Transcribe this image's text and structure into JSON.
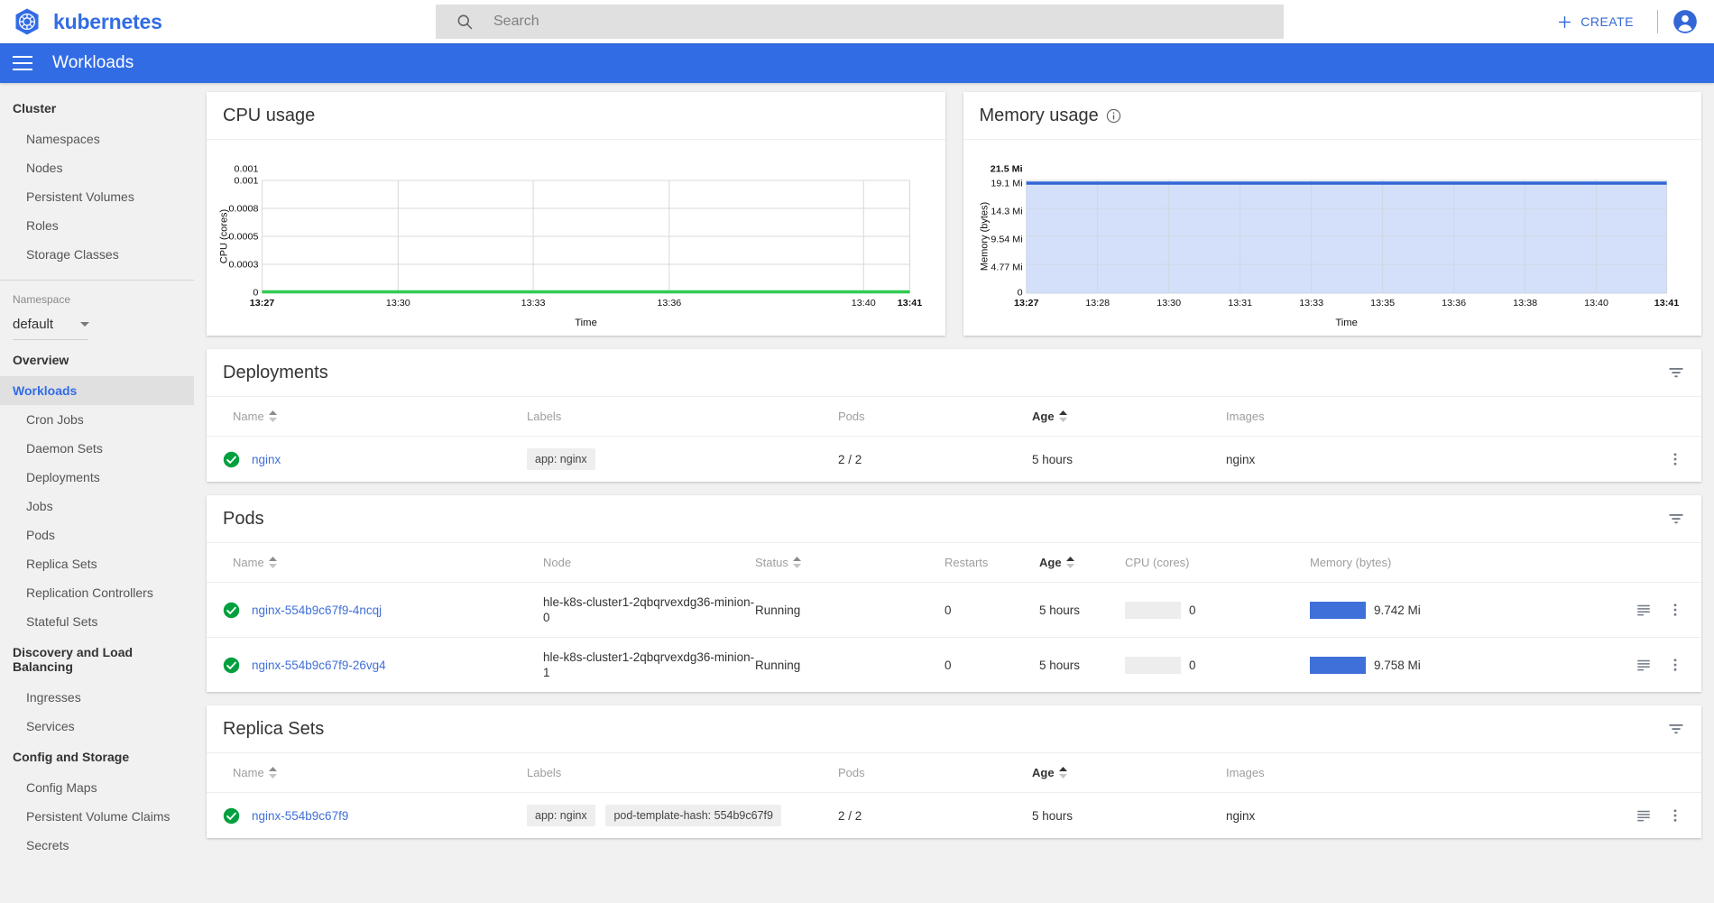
{
  "header": {
    "brand": "kubernetes",
    "logo_icon": "kubernetes-wheel-icon",
    "search_placeholder": "Search",
    "search_value": "",
    "search_icon": "search-icon",
    "create_label": "CREATE",
    "plus_icon": "plus-icon",
    "account_icon": "account-circle-icon"
  },
  "actionbar": {
    "menu_icon": "hamburger-menu-icon",
    "title": "Workloads"
  },
  "colors": {
    "brand_blue": "#326ce5",
    "link_blue": "#3f6fd8",
    "status_green": "#00a03e",
    "bar_blue": "#3f6fd8",
    "sidebar_bg": "#f1f1f1"
  },
  "sidebar": {
    "sections": [
      {
        "title": "Cluster",
        "items": [
          {
            "label": "Namespaces",
            "active": false
          },
          {
            "label": "Nodes",
            "active": false
          },
          {
            "label": "Persistent Volumes",
            "active": false
          },
          {
            "label": "Roles",
            "active": false
          },
          {
            "label": "Storage Classes",
            "active": false
          }
        ]
      },
      {
        "title": "Overview",
        "items": [
          {
            "label": "Workloads",
            "active": true
          },
          {
            "label": "Cron Jobs",
            "active": false
          },
          {
            "label": "Daemon Sets",
            "active": false
          },
          {
            "label": "Deployments",
            "active": false
          },
          {
            "label": "Jobs",
            "active": false
          },
          {
            "label": "Pods",
            "active": false
          },
          {
            "label": "Replica Sets",
            "active": false
          },
          {
            "label": "Replication Controllers",
            "active": false
          },
          {
            "label": "Stateful Sets",
            "active": false
          }
        ]
      },
      {
        "title": "Discovery and Load Balancing",
        "items": [
          {
            "label": "Ingresses",
            "active": false
          },
          {
            "label": "Services",
            "active": false
          }
        ]
      },
      {
        "title": "Config and Storage",
        "items": [
          {
            "label": "Config Maps",
            "active": false
          },
          {
            "label": "Persistent Volume Claims",
            "active": false
          },
          {
            "label": "Secrets",
            "active": false
          }
        ]
      }
    ],
    "namespace": {
      "label": "Namespace",
      "value": "default",
      "caret_icon": "chevron-down-icon"
    }
  },
  "chart_data": [
    {
      "type": "area",
      "title": "CPU usage",
      "xlabel": "Time",
      "ylabel": "CPU (cores)",
      "ytick_labels": [
        "0.001",
        "0.001",
        "0.0008",
        "0.0005",
        "0.0003",
        "0"
      ],
      "ytick_values": [
        0.0011,
        0.001,
        0.0008,
        0.0005,
        0.0003,
        0
      ],
      "ylim": [
        0,
        0.0011
      ],
      "xtick_labels": [
        "13:27",
        "13:30",
        "13:33",
        "13:36",
        "13:40",
        "13:41"
      ],
      "x": [
        "13:27",
        "13:30",
        "13:33",
        "13:36",
        "13:40",
        "13:41"
      ],
      "values": [
        0,
        0,
        0,
        0,
        0,
        0
      ],
      "line_color": "#2ecc51",
      "fill_color": "#d9f0df",
      "grid": true,
      "legend": "none"
    },
    {
      "type": "area",
      "title": "Memory usage",
      "info_icon": "info-icon",
      "xlabel": "Time",
      "ylabel": "Memory (bytes)",
      "ytick_labels": [
        "21.5 Mi",
        "19.1 Mi",
        "14.3 Mi",
        "9.54 Mi",
        "4.77 Mi",
        "0"
      ],
      "ytick_values": [
        21.5,
        19.1,
        14.3,
        9.54,
        4.77,
        0
      ],
      "ylim": [
        0,
        21.5
      ],
      "xtick_labels": [
        "13:27",
        "13:28",
        "13:30",
        "13:31",
        "13:33",
        "13:35",
        "13:36",
        "13:38",
        "13:40",
        "13:41"
      ],
      "x": [
        "13:27",
        "13:28",
        "13:30",
        "13:31",
        "13:33",
        "13:35",
        "13:36",
        "13:38",
        "13:40",
        "13:41"
      ],
      "values": [
        19.5,
        19.5,
        19.5,
        19.5,
        19.5,
        19.5,
        19.5,
        19.5,
        19.5,
        19.5
      ],
      "line_color": "#3266d6",
      "fill_color": "#d4e0fa",
      "grid": true,
      "legend": "none"
    }
  ],
  "deployments": {
    "title": "Deployments",
    "filter_icon": "filter-icon",
    "columns": [
      {
        "label": "Name",
        "sortable": true,
        "sorted": false
      },
      {
        "label": "Labels",
        "sortable": false,
        "sorted": false
      },
      {
        "label": "Pods",
        "sortable": false,
        "sorted": false
      },
      {
        "label": "Age",
        "sortable": true,
        "sorted": true
      },
      {
        "label": "Images",
        "sortable": false,
        "sorted": false
      }
    ],
    "rows": [
      {
        "status_icon": "check-circle-icon",
        "name": "nginx",
        "labels": [
          "app: nginx"
        ],
        "pods": "2 / 2",
        "age": "5 hours",
        "images": "nginx",
        "menu_icon": "more-vert-icon"
      }
    ]
  },
  "pods": {
    "title": "Pods",
    "filter_icon": "filter-icon",
    "columns": [
      {
        "label": "Name",
        "sortable": true,
        "sorted": false
      },
      {
        "label": "Node",
        "sortable": false,
        "sorted": false
      },
      {
        "label": "Status",
        "sortable": true,
        "sorted": false
      },
      {
        "label": "Restarts",
        "sortable": false,
        "sorted": false
      },
      {
        "label": "Age",
        "sortable": true,
        "sorted": true
      },
      {
        "label": "CPU (cores)",
        "sortable": false,
        "sorted": false
      },
      {
        "label": "Memory (bytes)",
        "sortable": false,
        "sorted": false
      }
    ],
    "rows": [
      {
        "status_icon": "check-circle-icon",
        "name": "nginx-554b9c67f9-4ncqj",
        "node": "hle-k8s-cluster1-2qbqrvexdg36-minion-0",
        "status": "Running",
        "restarts": "0",
        "age": "5 hours",
        "cpu": "0",
        "cpu_bar_pct": 0,
        "memory": "9.742 Mi",
        "memory_bar_pct": 100,
        "logs_icon": "logs-icon",
        "menu_icon": "more-vert-icon"
      },
      {
        "status_icon": "check-circle-icon",
        "name": "nginx-554b9c67f9-26vg4",
        "node": "hle-k8s-cluster1-2qbqrvexdg36-minion-1",
        "status": "Running",
        "restarts": "0",
        "age": "5 hours",
        "cpu": "0",
        "cpu_bar_pct": 0,
        "memory": "9.758 Mi",
        "memory_bar_pct": 100,
        "logs_icon": "logs-icon",
        "menu_icon": "more-vert-icon"
      }
    ]
  },
  "replica_sets": {
    "title": "Replica Sets",
    "filter_icon": "filter-icon",
    "columns": [
      {
        "label": "Name",
        "sortable": true,
        "sorted": false
      },
      {
        "label": "Labels",
        "sortable": false,
        "sorted": false
      },
      {
        "label": "Pods",
        "sortable": false,
        "sorted": false
      },
      {
        "label": "Age",
        "sortable": true,
        "sorted": true
      },
      {
        "label": "Images",
        "sortable": false,
        "sorted": false
      }
    ],
    "rows": [
      {
        "status_icon": "check-circle-icon",
        "name": "nginx-554b9c67f9",
        "labels": [
          "app: nginx",
          "pod-template-hash: 554b9c67f9"
        ],
        "pods": "2 / 2",
        "age": "5 hours",
        "images": "nginx",
        "logs_icon": "logs-icon",
        "menu_icon": "more-vert-icon"
      }
    ]
  }
}
